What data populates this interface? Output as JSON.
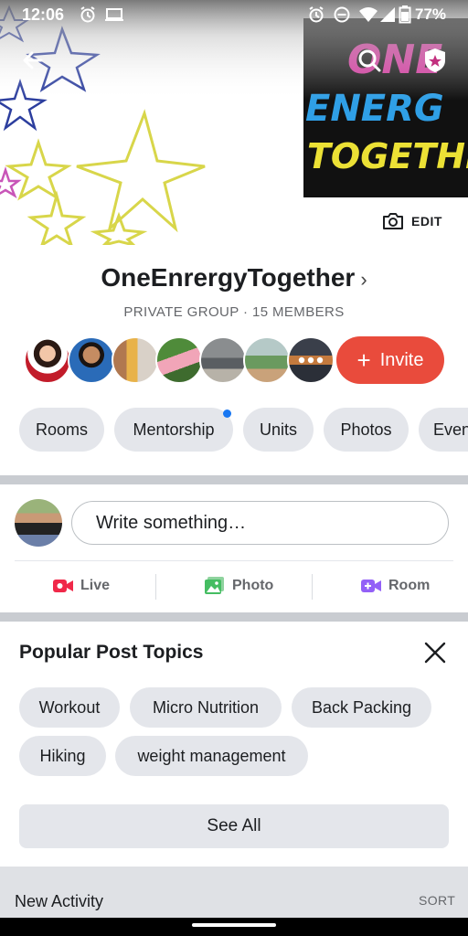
{
  "status_bar": {
    "time": "12:06",
    "battery_percent": "77%",
    "icons": [
      "alarm-icon",
      "laptop-icon",
      "alarm-icon",
      "dnd-icon",
      "wifi-icon",
      "signal-icon",
      "battery-icon"
    ]
  },
  "cover": {
    "logo_text": [
      "ONE",
      "ENERGY",
      "TOGETHER"
    ],
    "edit_label": "EDIT"
  },
  "group": {
    "name": "OneEnrergyTogether",
    "meta": "PRIVATE GROUP · 15 MEMBERS",
    "invite_label": "Invite",
    "more_members_icon": "more-dots-icon"
  },
  "tabs": [
    {
      "label": "Rooms"
    },
    {
      "label": "Mentorship"
    },
    {
      "label": "Units"
    },
    {
      "label": "Photos"
    },
    {
      "label": "Even"
    }
  ],
  "composer": {
    "placeholder": "Write something…",
    "actions": [
      {
        "label": "Live",
        "icon": "live-video-icon",
        "color": "#f02849"
      },
      {
        "label": "Photo",
        "icon": "photo-icon",
        "color": "#45bd62"
      },
      {
        "label": "Room",
        "icon": "room-video-icon",
        "color": "#9360f7"
      }
    ]
  },
  "topics": {
    "title": "Popular Post Topics",
    "items": [
      "Workout",
      "Micro Nutrition",
      "Back Packing",
      "Hiking",
      "weight management"
    ],
    "see_all_label": "See All"
  },
  "activity": {
    "title": "New Activity",
    "sort_label": "SORT"
  },
  "colors": {
    "accent": "#e94b3c",
    "chip_bg": "#e4e6eb",
    "notification_dot": "#1877f2"
  }
}
